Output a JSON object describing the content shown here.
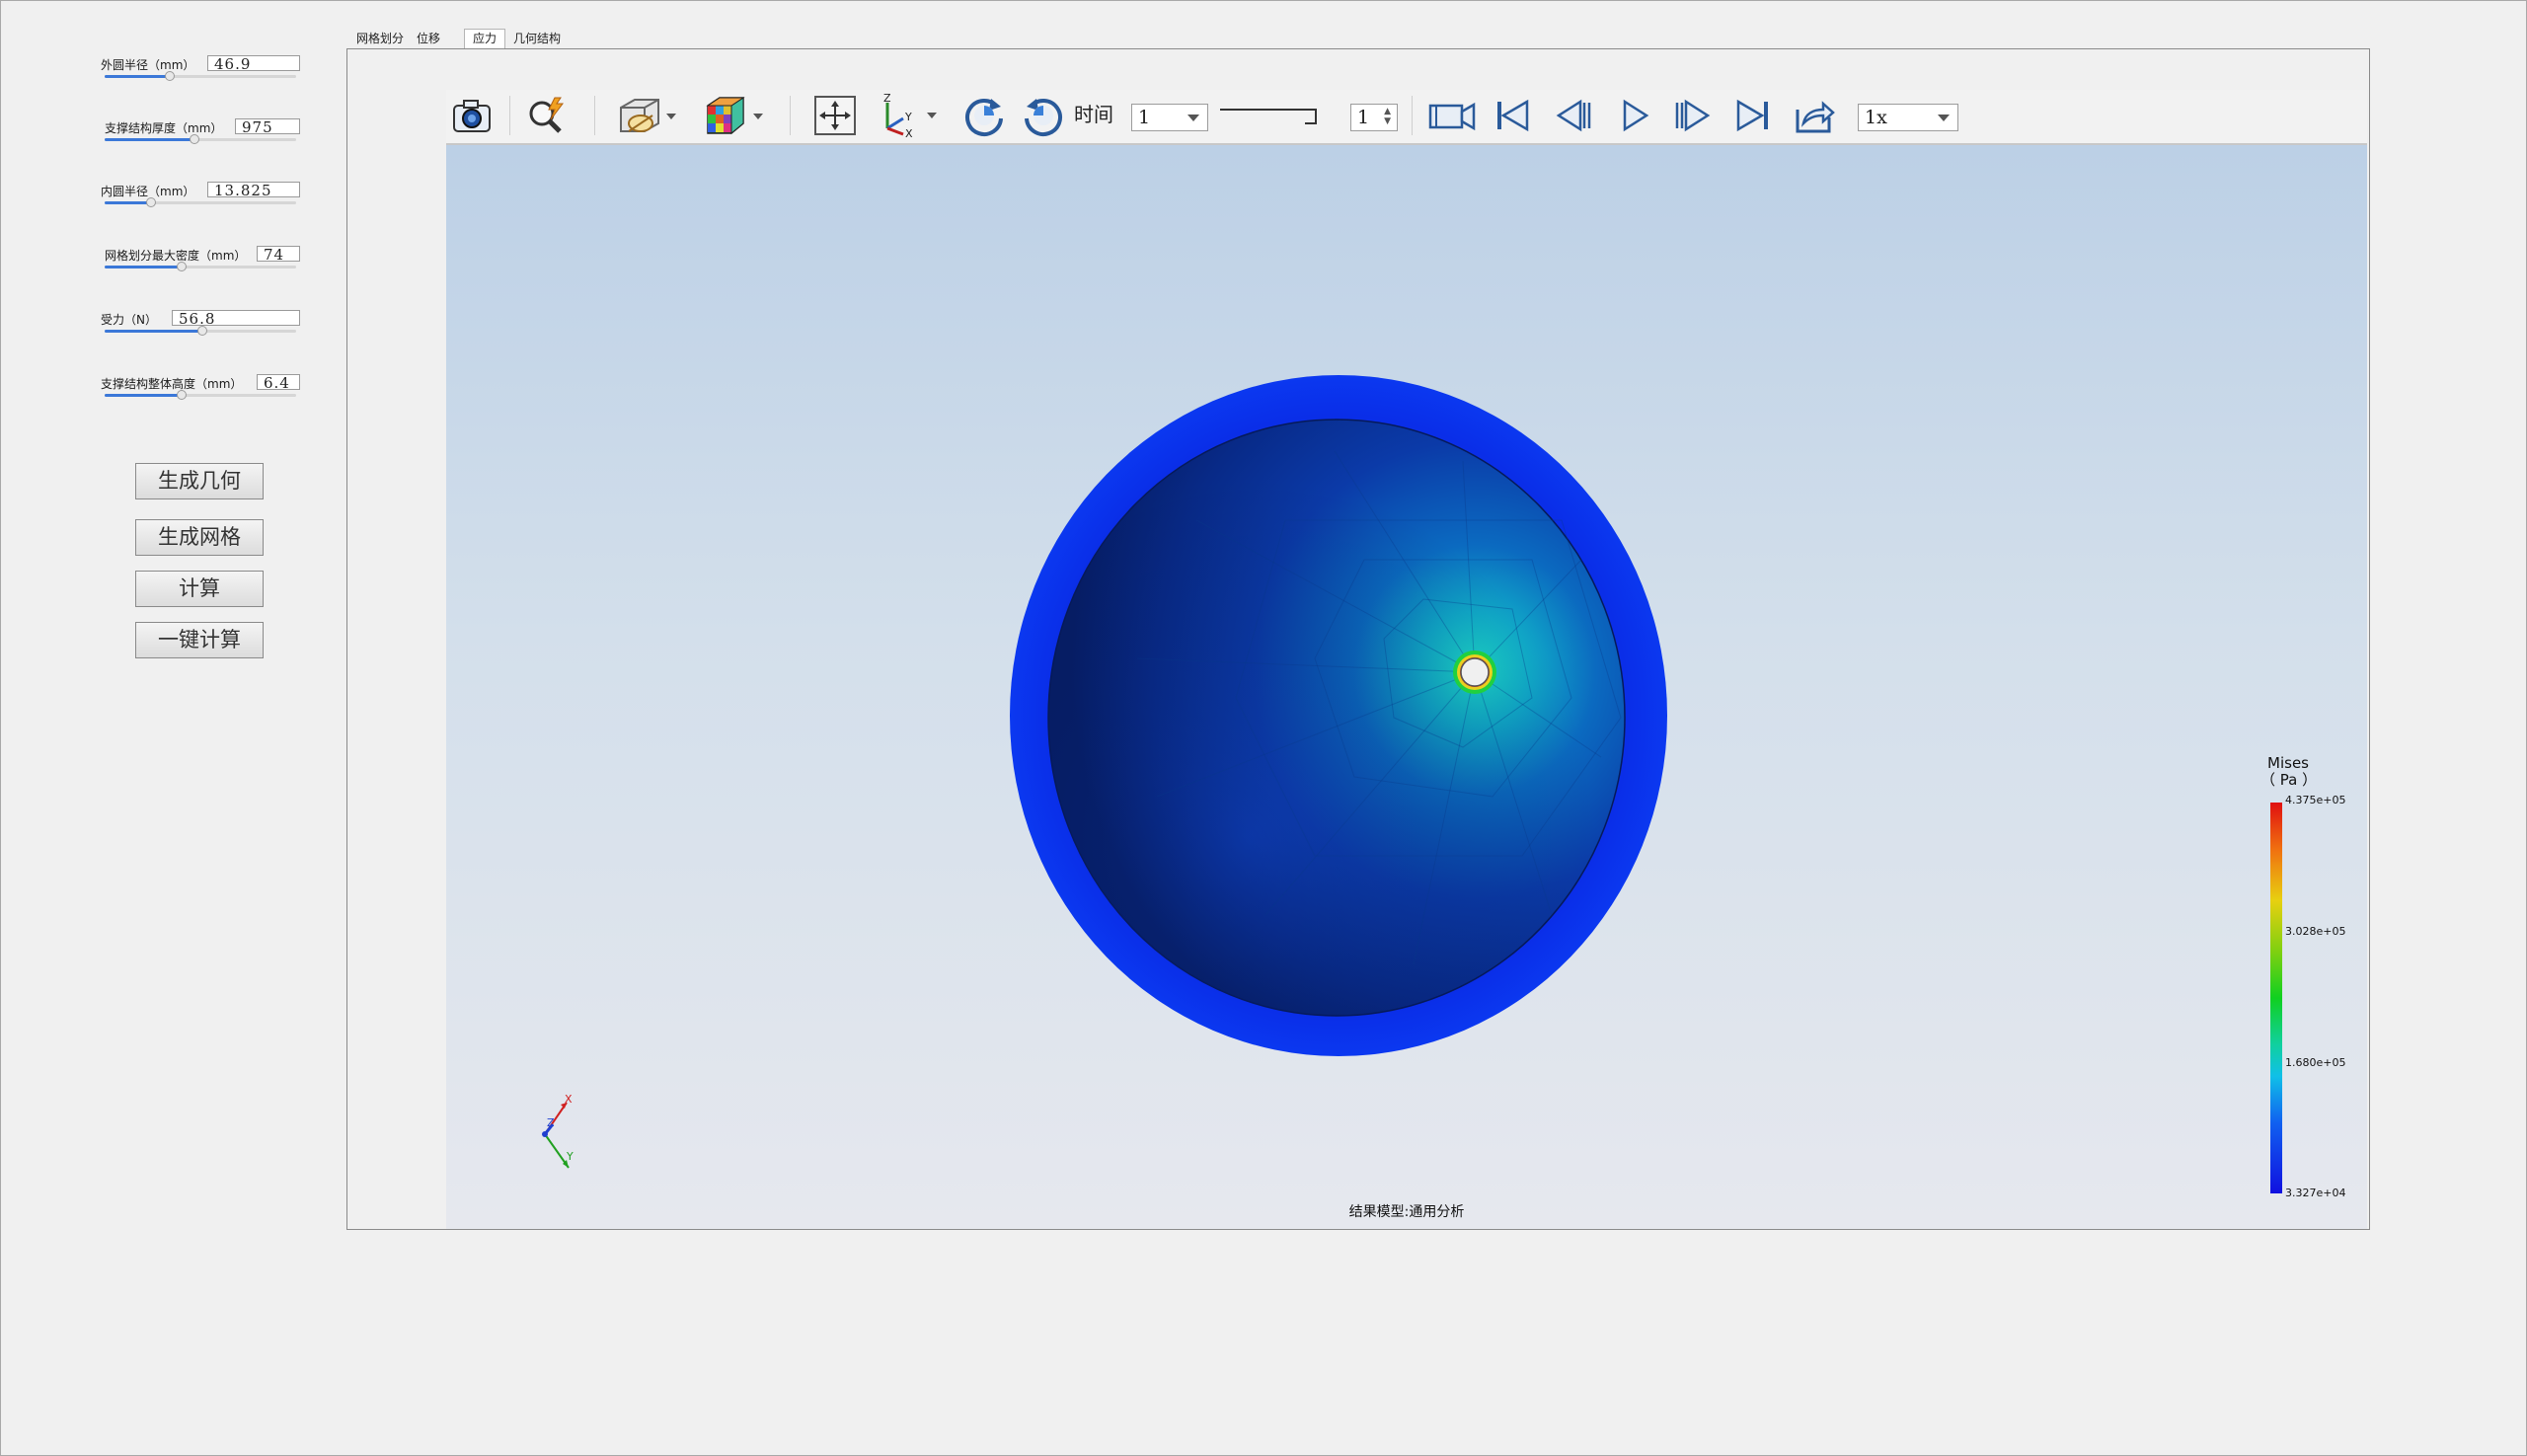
{
  "params": [
    {
      "label": "外圆半径（mm）",
      "value": "46.9",
      "fill": 0.34
    },
    {
      "label": "支撑结构厚度（mm）",
      "value": "975",
      "fill": 0.47
    },
    {
      "label": "内圆半径（mm）",
      "value": "13.825",
      "fill": 0.24
    },
    {
      "label": "网格划分最大密度（mm）",
      "value": "74",
      "fill": 0.4
    },
    {
      "label": "受力（N）",
      "value": "56.8",
      "fill": 0.51
    },
    {
      "label": "支撑结构整体高度（mm）",
      "value": "6.4",
      "fill": 0.4
    }
  ],
  "actions": {
    "gen_geometry": "生成几何",
    "gen_mesh": "生成网格",
    "compute": "计算",
    "one_click": "一键计算"
  },
  "tabs": [
    "网格划分",
    "位移",
    "应力",
    "几何结构"
  ],
  "active_tab": "应力",
  "toolbar": {
    "time_label": "时间",
    "time_value": "1",
    "frame_value": "1",
    "speed_value": "1x",
    "icons": [
      "camera-icon",
      "query-icon",
      "display-mode-icon",
      "color-cube-icon",
      "fit-view-icon",
      "axes-icon",
      "rotate-cw-icon",
      "rotate-ccw-icon",
      "record-icon",
      "first-frame-icon",
      "prev-frame-icon",
      "play-icon",
      "next-frame-icon",
      "last-frame-icon",
      "export-icon"
    ]
  },
  "viewport": {
    "status": "结果模型:通用分析",
    "triad_labels": [
      "X",
      "Z",
      "Y"
    ]
  },
  "legend": {
    "title_line1": "Mises",
    "title_line2": "（ Pa ）",
    "ticks": [
      "4.375e+05",
      "3.028e+05",
      "1.680e+05",
      "3.327e+04"
    ],
    "colors": {
      "max": "#e01010",
      "mid": "#10d020",
      "min": "#1010e0"
    }
  }
}
